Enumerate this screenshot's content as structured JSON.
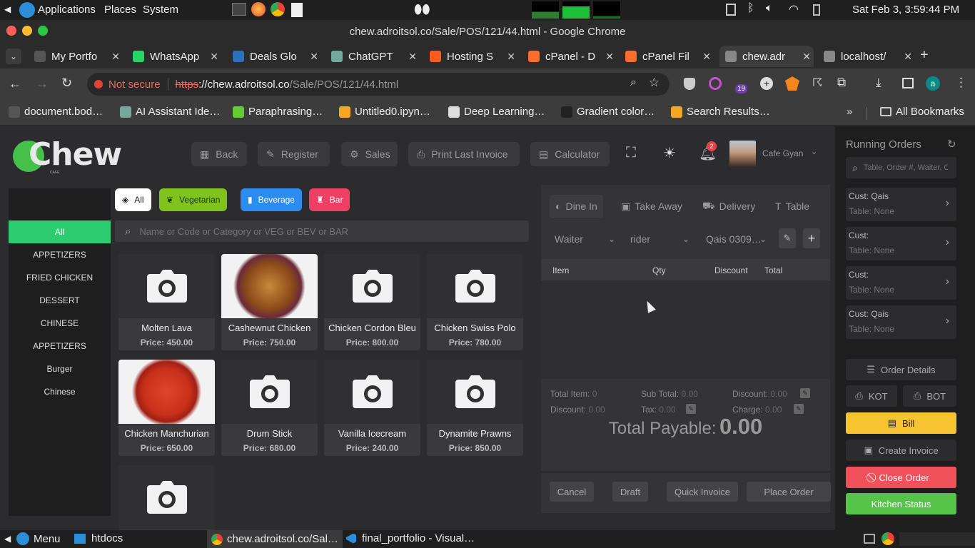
{
  "os_panel": {
    "menus": [
      "Applications",
      "Places",
      "System"
    ],
    "clock": "Sat Feb 3,  3:59:44 PM"
  },
  "browser": {
    "window_title": "chew.adroitsol.co/Sale/POS/121/44.html - Google Chrome",
    "tabs": [
      {
        "label": "My Portfo",
        "color": "#555"
      },
      {
        "label": "WhatsApp",
        "color": "#25d366"
      },
      {
        "label": "Deals Glo",
        "color": "#2c6fbb"
      },
      {
        "label": "ChatGPT",
        "color": "#74aa9c"
      },
      {
        "label": "Hosting S",
        "color": "#ff5a1f"
      },
      {
        "label": "cPanel - D",
        "color": "#ff6c2c"
      },
      {
        "label": "cPanel Fil",
        "color": "#ff6c2c"
      },
      {
        "label": "chew.adr",
        "color": "#888"
      },
      {
        "label": "localhost/",
        "color": "#888"
      }
    ],
    "security": "Not secure",
    "url_scheme": "https",
    "url_host": "://chew.adroitsol.co",
    "url_path": "/Sale/POS/121/44.html",
    "profile_initial": "a",
    "extension_badge": "19",
    "bookmarks": [
      "document.bod…",
      "AI Assistant Ide…",
      "Paraphrasing…",
      "Untitled0.ipyn…",
      "Deep Learning…",
      "Gradient color…",
      "Search Results…"
    ],
    "all_bookmarks": "All Bookmarks"
  },
  "app": {
    "logo": "Chew",
    "logo_sub": "CAFE",
    "top_buttons": [
      "Back",
      "Register",
      "Sales",
      "Print Last Invoice",
      "Calculator"
    ],
    "notification_count": "2",
    "user_name": "Cafe Gyan",
    "filter_chips": [
      {
        "label": "All",
        "bg": "#ffffff",
        "fg": "#222"
      },
      {
        "label": "Vegetarian",
        "bg": "#7fc31c",
        "fg": "#1a3a00"
      },
      {
        "label": "Beverage",
        "bg": "#2d8cf0",
        "fg": "#fff"
      },
      {
        "label": "Bar",
        "bg": "#ed4064",
        "fg": "#fff"
      }
    ],
    "search_placeholder": "Name or Code or Category or VEG or BEV or BAR",
    "categories": [
      "All",
      "APPETIZERS",
      "FRIED CHICKEN",
      "DESSERT",
      "CHINESE",
      "APPETIZERS",
      "Burger",
      "Chinese"
    ],
    "products": [
      {
        "name": "Molten Lava",
        "price": "Price: 450.00",
        "image": "camera-icon"
      },
      {
        "name": "Cashewnut Chicken",
        "price": "Price: 750.00",
        "image": "photo"
      },
      {
        "name": "Chicken Cordon Bleu",
        "price": "Price: 800.00",
        "image": "camera-icon"
      },
      {
        "name": "Chicken Swiss Polo",
        "price": "Price: 780.00",
        "image": "camera-icon"
      },
      {
        "name": "Chicken Manchurian",
        "price": "Price: 650.00",
        "image": "photo"
      },
      {
        "name": "Drum Stick",
        "price": "Price: 680.00",
        "image": "camera-icon"
      },
      {
        "name": "Vanilla Icecream",
        "price": "Price: 240.00",
        "image": "camera-icon"
      },
      {
        "name": "Dynamite Prawns",
        "price": "Price: 850.00",
        "image": "camera-icon"
      },
      {
        "name": "",
        "price": "",
        "image": "camera-icon"
      }
    ],
    "order": {
      "types": [
        "Dine In",
        "Take Away",
        "Delivery",
        "Table"
      ],
      "waiter": "Waiter",
      "rider": "rider",
      "customer": "Qais 0309…",
      "columns": [
        "Item",
        "Qty",
        "Discount",
        "Total"
      ],
      "total_item_label": "Total Item:",
      "total_item": "0",
      "sub_total_label": "Sub Total:",
      "sub_total": "0.00",
      "discount_label": "Discount:",
      "discount": "0.00",
      "discount2": "0.00",
      "tax_label": "Tax:",
      "tax": "0.00",
      "charge_label": "Charge:",
      "charge": "0.00",
      "total_payable_label": "Total Payable:",
      "total_payable": "0.00",
      "actions": [
        "Cancel",
        "Draft",
        "Quick Invoice",
        "Place Order"
      ]
    },
    "running_orders": {
      "title": "Running Orders",
      "search_placeholder": "Table, Order #, Waiter, Cust",
      "items": [
        {
          "cust": "Cust: Qais",
          "table": "Table: None"
        },
        {
          "cust": "Cust:",
          "table": "Table: None"
        },
        {
          "cust": "Cust:",
          "table": "Table: None"
        },
        {
          "cust": "Cust: Qais",
          "table": "Table: None"
        }
      ],
      "buttons": {
        "order_details": "Order Details",
        "kot": "KOT",
        "bot": "BOT",
        "bill": "Bill",
        "create_invoice": "Create Invoice",
        "close_order": "Close Order",
        "kitchen_status": "Kitchen Status"
      }
    }
  },
  "taskbar": {
    "menu": "Menu",
    "items": [
      "htdocs",
      "chew.adroitsol.co/Sal…",
      "final_portfolio - Visual…"
    ]
  }
}
